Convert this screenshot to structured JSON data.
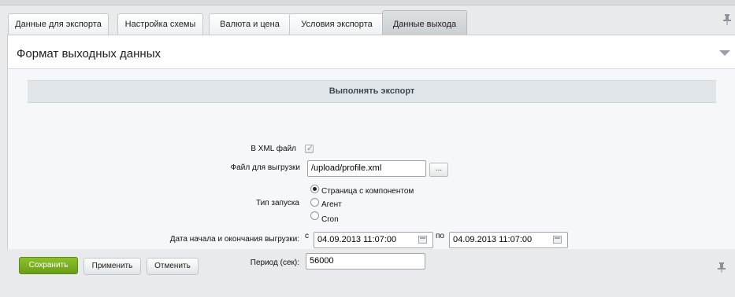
{
  "tabs": [
    {
      "label": "Данные для экспорта"
    },
    {
      "label": "Настройка схемы"
    },
    {
      "label": "Валюта и цена"
    },
    {
      "label": "Условия экспорта"
    },
    {
      "label": "Данные выхода"
    }
  ],
  "active_tab": "Данные выхода",
  "panel": {
    "title": "Формат выходных данных",
    "section_title": "Выполнять экспорт"
  },
  "form": {
    "xml_label": "В XML файл",
    "xml_checked": true,
    "file_label": "Файл для выгрузки",
    "file_value": "/upload/profile.xml",
    "browse_label": "...",
    "run_type_label": "Тип запуска",
    "run_options": [
      "Страница с компонентом",
      "Агент",
      "Cron"
    ],
    "run_selected": "Страница с компонентом",
    "date_label": "Дата начала и окончания выгрузки:",
    "from_label": "с",
    "date_from": "04.09.2013 11:07:00",
    "to_label": "по",
    "date_to": "04.09.2013 11:07:00",
    "period_label": "Период (сек):",
    "period_value": "56000"
  },
  "buttons": {
    "save": "Сохранить",
    "apply": "Применить",
    "cancel": "Отменить"
  },
  "icons": {
    "pin": "pin-icon",
    "collapse": "collapse-arrow-icon",
    "calendar": "calendar-icon"
  },
  "colors": {
    "save_button": "#7aaf22",
    "section_header": "#e0e6e9",
    "page_background": "#e9eaec"
  }
}
